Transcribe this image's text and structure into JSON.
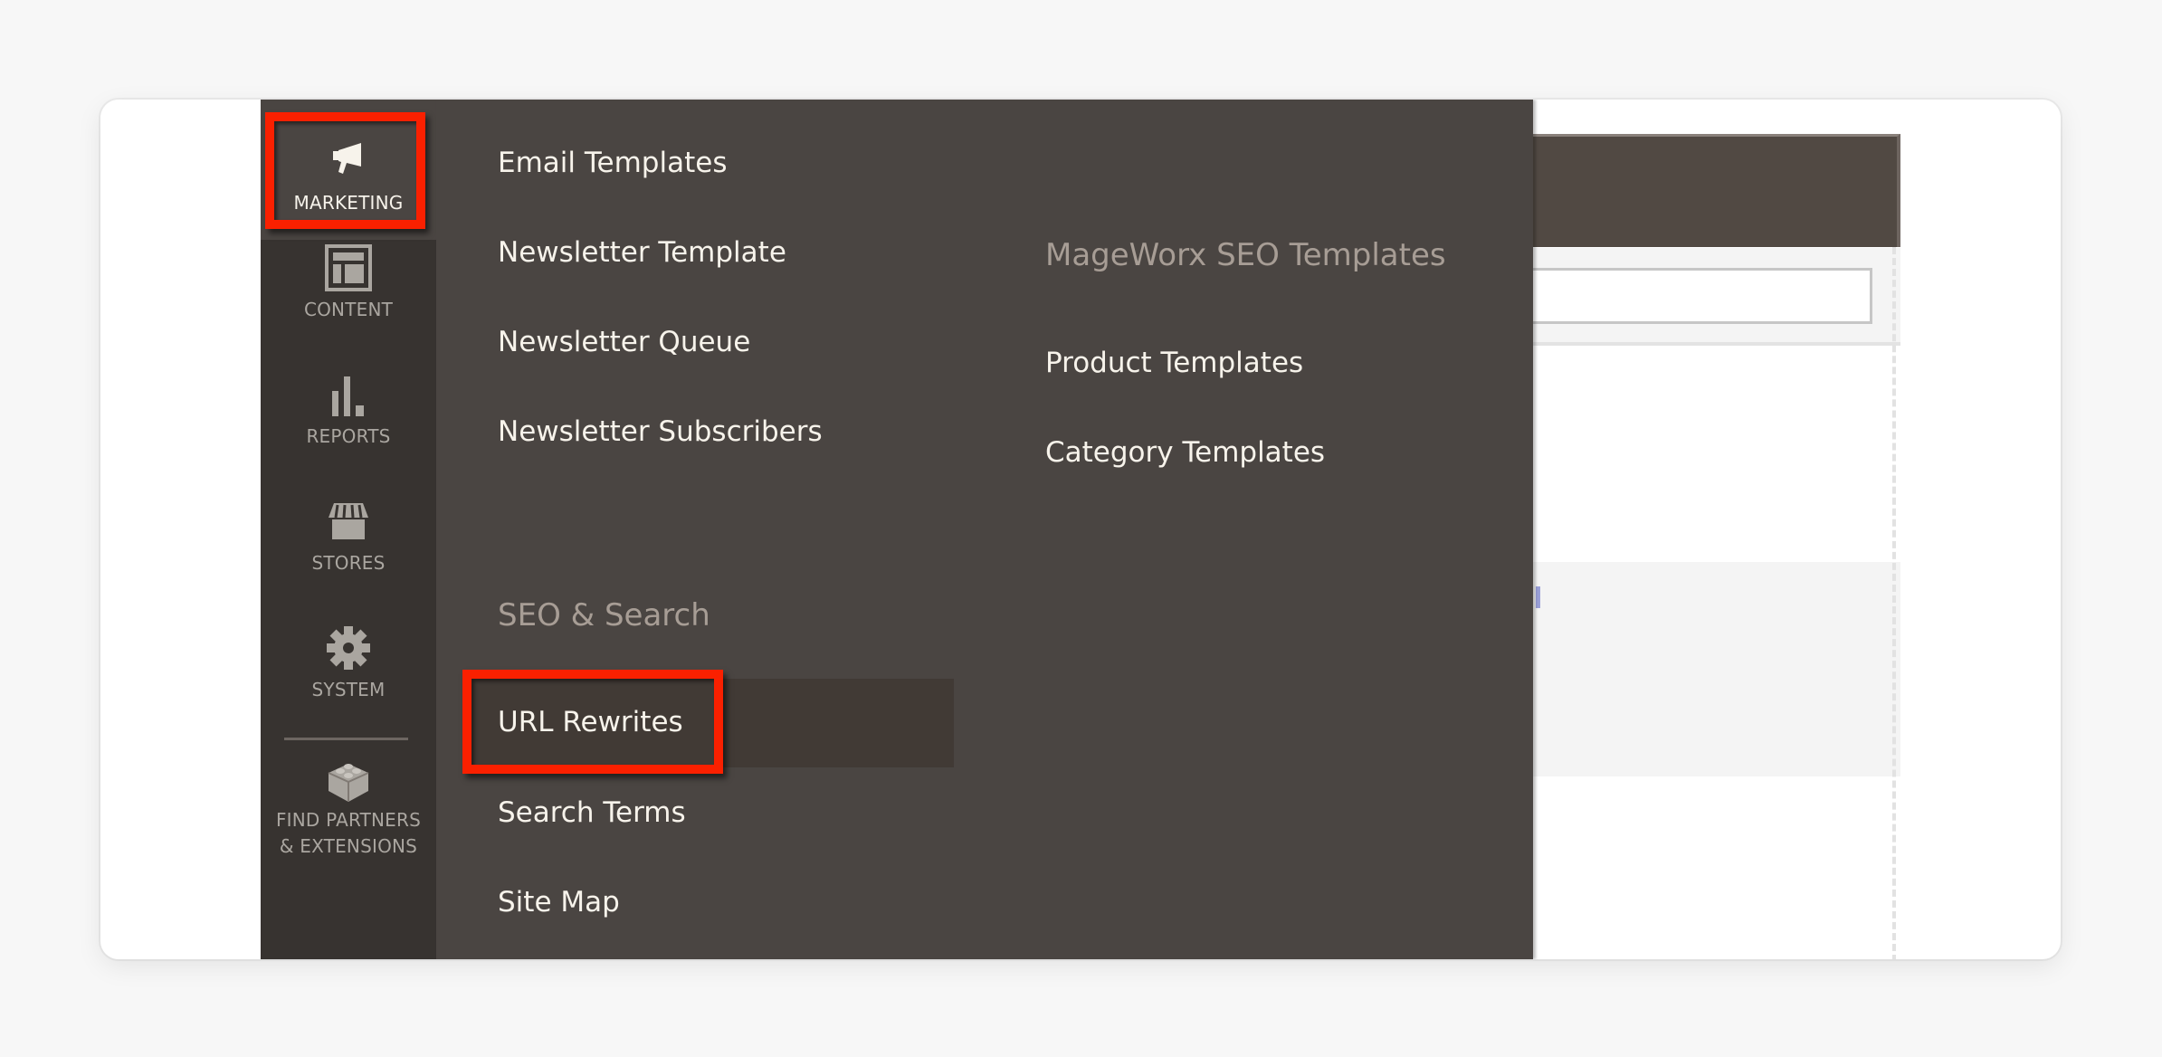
{
  "sidebar": {
    "items": [
      {
        "label": "MARKETING",
        "icon": "megaphone-icon",
        "active": true
      },
      {
        "label": "CONTENT",
        "icon": "layout-icon"
      },
      {
        "label": "REPORTS",
        "icon": "bar-chart-icon"
      },
      {
        "label": "STORES",
        "icon": "storefront-icon"
      },
      {
        "label": "SYSTEM",
        "icon": "gear-icon"
      },
      {
        "label_line1": "FIND PARTNERS",
        "label_line2": "& EXTENSIONS",
        "icon": "lego-block-icon"
      }
    ]
  },
  "menu": {
    "column1": {
      "items": [
        "Email Templates",
        "Newsletter Template",
        "Newsletter Queue",
        "Newsletter Subscribers"
      ],
      "section_heading": "SEO & Search",
      "section_items": [
        "URL Rewrites",
        "Search Terms",
        "Site Map"
      ]
    },
    "column2": {
      "heading": "MageWorx SEO Templates",
      "items": [
        "Product Templates",
        "Category Templates"
      ]
    }
  },
  "highlights": {
    "color": "#fa2000",
    "targets": [
      "MARKETING",
      "URL Rewrites"
    ]
  }
}
